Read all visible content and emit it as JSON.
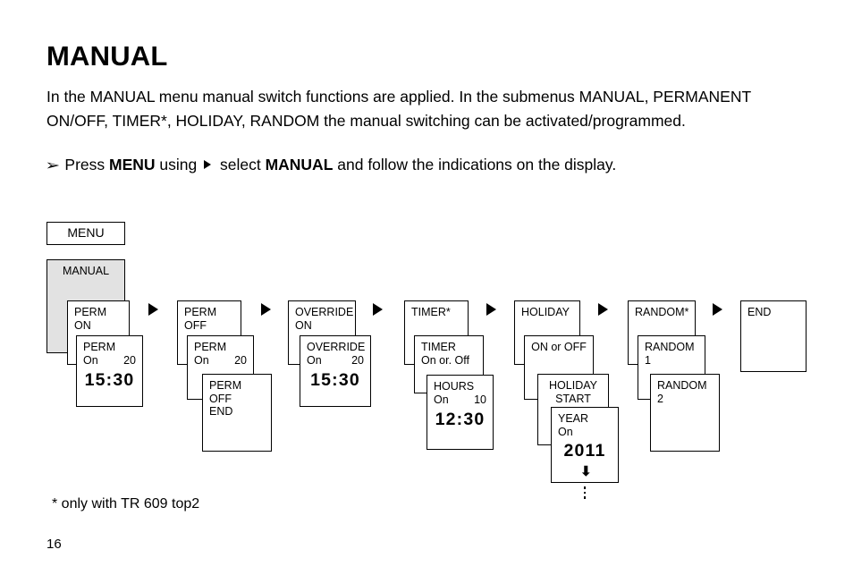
{
  "page": {
    "title": "MANUAL",
    "intro": "In the MANUAL menu manual switch functions are applied. In the submenus MANUAL, PERMANENT ON/OFF, TIMER*, HOLIDAY, RANDOM the manual switching can be activated/programmed.",
    "instruction": {
      "bullet": "➢",
      "part1": "Press ",
      "key1": "MENU",
      "part2": " using ",
      "arrow_icon": "right-triangle",
      "part3": " select ",
      "key2": "MANUAL",
      "part4": " and follow the indications on the display."
    },
    "footnote": "* only with TR 609 top2",
    "page_number": "16"
  },
  "diagram": {
    "menu_button": "MENU",
    "root": "MANUAL",
    "flow_arrow_icon": "right-triangle",
    "down_arrow_icon": "⬇",
    "continuation_icon": "vertical-ellipsis",
    "branches": [
      {
        "id": "perm-on",
        "head": "PERM ON",
        "cards": [
          {
            "title": "PERM",
            "key": "On",
            "value": "20",
            "big": "15:30"
          }
        ]
      },
      {
        "id": "perm-off",
        "head": "PERM OFF",
        "cards": [
          {
            "title": "PERM",
            "key": "On",
            "value": "20"
          },
          {
            "title": "PERM OFF",
            "subtitle": "END"
          }
        ]
      },
      {
        "id": "override-on",
        "head": "OVERRIDE",
        "head2": "ON",
        "cards": [
          {
            "title": "OVERRIDE",
            "key": "On",
            "value": "20",
            "big": "15:30"
          }
        ]
      },
      {
        "id": "timer",
        "head": "TIMER*",
        "cards": [
          {
            "title": "TIMER",
            "subtitle": "On or. Off"
          },
          {
            "title": "HOURS",
            "key": "On",
            "value": "10",
            "big": "12:30"
          }
        ]
      },
      {
        "id": "holiday",
        "head": "HOLIDAY",
        "cards": [
          {
            "title": "ON or OFF"
          },
          {
            "title": "HOLIDAY",
            "subtitle": "START"
          },
          {
            "title": "YEAR",
            "key": "On",
            "big": "2011"
          }
        ]
      },
      {
        "id": "random",
        "head": "RANDOM*",
        "cards": [
          {
            "title": "RANDOM 1"
          },
          {
            "title": "RANDOM 2"
          }
        ]
      },
      {
        "id": "end",
        "head": "END",
        "cards": []
      }
    ]
  }
}
